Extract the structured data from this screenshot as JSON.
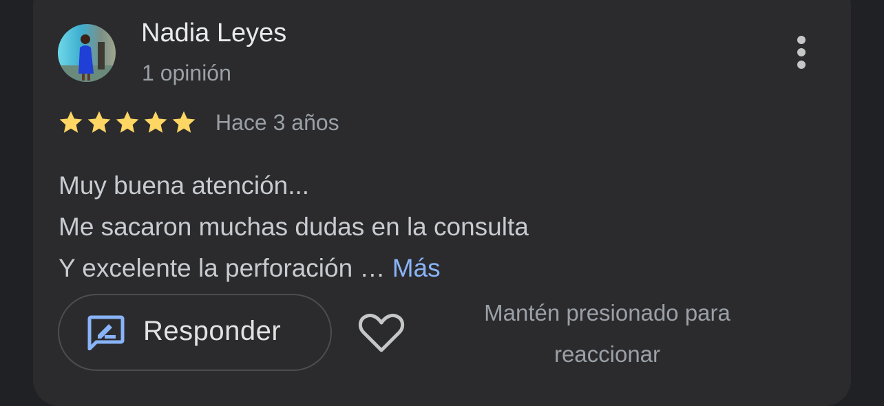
{
  "review": {
    "author_name": "Nadia Leyes",
    "author_meta": "1 opinión",
    "rating": 5,
    "rating_max": 5,
    "timestamp": "Hace 3 años",
    "text_lines": [
      "Muy buena atención...",
      "Me sacaron muchas dudas en la consulta",
      "Y excelente la perforación …"
    ],
    "more_label": "Más"
  },
  "actions": {
    "reply_label": "Responder",
    "react_hint": "Mantén presionado para reaccionar"
  },
  "icons": {
    "avatar": "avatar-photo",
    "more": "more-vert-icon",
    "star": "star-icon",
    "reply": "rate-review-icon",
    "like": "heart-outline-icon"
  },
  "colors": {
    "card_background": "#2b2b2e",
    "star": "#fdd663",
    "link": "#8ab4f8",
    "reply_icon": "#8ab4f8"
  }
}
